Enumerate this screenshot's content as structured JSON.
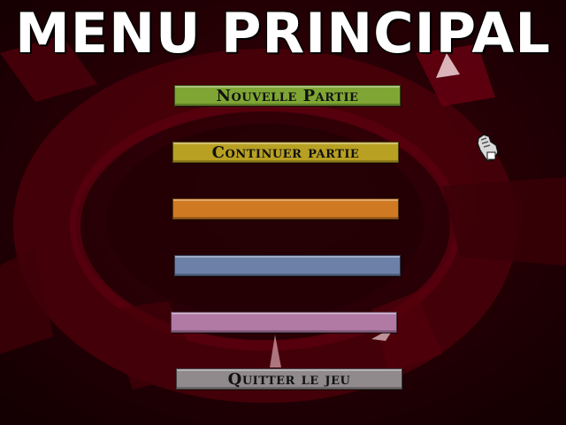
{
  "screen": {
    "title": "MENU PRINCIPAL"
  },
  "menu": {
    "items": [
      {
        "label": "Nouvelle Partie",
        "color": "#7fa634"
      },
      {
        "label": "Continuer partie",
        "color": "#b8a022"
      },
      {
        "label": "",
        "color": "#cf7a22"
      },
      {
        "label": "",
        "color": "#6d80a8"
      },
      {
        "label": "",
        "color": "#b07aa5"
      },
      {
        "label": "Quitter le jeu",
        "color": "#908a8c"
      }
    ]
  },
  "colors": {
    "background": "#1e0004",
    "accent_red": "#6a0010",
    "title": "#ffffff"
  },
  "cursor": {
    "icon": "gauntlet-hand-cursor-icon"
  }
}
